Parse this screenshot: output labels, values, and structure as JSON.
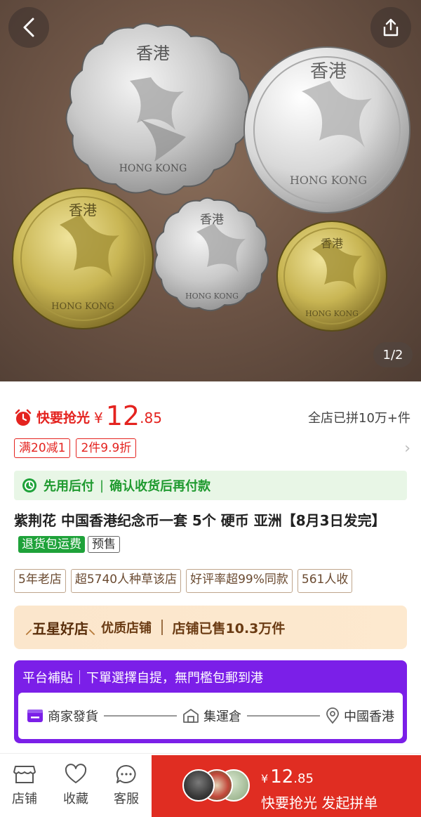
{
  "hero": {
    "page_indicator": "1/2",
    "coin_texts": {
      "top": "香港",
      "bottom": "HONG KONG"
    }
  },
  "price": {
    "rush_label": "快要抢光",
    "currency": "¥",
    "integer": "12",
    "decimal": ".85",
    "group_sold": "全店已拼10万+件",
    "color": "#e4231f"
  },
  "coupons": [
    "满20减1",
    "2件9.9折"
  ],
  "pay_later": {
    "left": "先用后付",
    "right": "确认收货后再付款"
  },
  "title": {
    "text": "紫荆花 中国香港纪念币一套 5个 硬币 亚洲【8月3日发完】",
    "tag_green": "退货包运费",
    "tag_outline": "预售"
  },
  "shop_tags": [
    "5年老店",
    "超5740人种草该店",
    "好评率超99%同款",
    "561人收"
  ],
  "star_shop": {
    "title": "五星好店",
    "subtitle": "优质店铺",
    "sales": "店铺已售10.3万件"
  },
  "subsidy": {
    "title": "平台補貼",
    "desc": "下單選擇自提，無門檻包郵到港",
    "steps": [
      "商家發貨",
      "集運倉",
      "中國香港"
    ],
    "color": "#7b1fe8"
  },
  "bottom": {
    "shop": "店铺",
    "favorite": "收藏",
    "service": "客服",
    "buy_currency": "¥",
    "buy_integer": "12",
    "buy_decimal": ".85",
    "buy_label": "快要抢光 发起拼单",
    "buy_color": "#e02d22"
  }
}
